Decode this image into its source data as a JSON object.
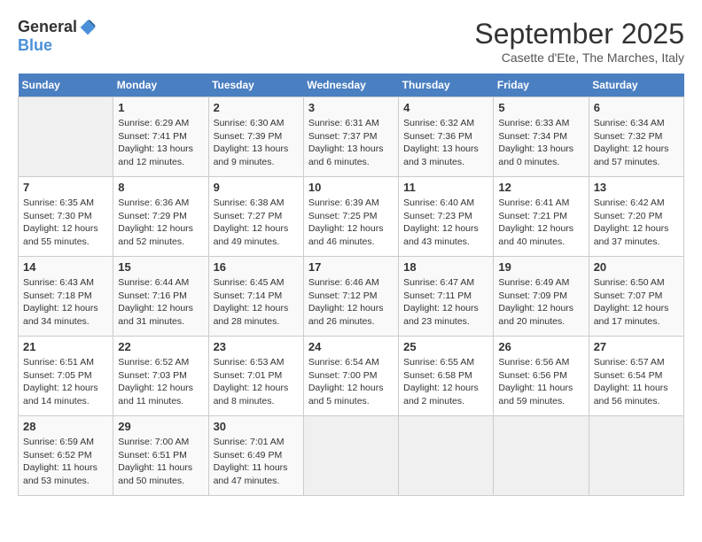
{
  "logo": {
    "general": "General",
    "blue": "Blue"
  },
  "header": {
    "month": "September 2025",
    "location": "Casette d'Ete, The Marches, Italy"
  },
  "weekdays": [
    "Sunday",
    "Monday",
    "Tuesday",
    "Wednesday",
    "Thursday",
    "Friday",
    "Saturday"
  ],
  "weeks": [
    [
      {
        "day": "",
        "empty": true
      },
      {
        "day": "1",
        "sunrise": "Sunrise: 6:29 AM",
        "sunset": "Sunset: 7:41 PM",
        "daylight": "Daylight: 13 hours and 12 minutes."
      },
      {
        "day": "2",
        "sunrise": "Sunrise: 6:30 AM",
        "sunset": "Sunset: 7:39 PM",
        "daylight": "Daylight: 13 hours and 9 minutes."
      },
      {
        "day": "3",
        "sunrise": "Sunrise: 6:31 AM",
        "sunset": "Sunset: 7:37 PM",
        "daylight": "Daylight: 13 hours and 6 minutes."
      },
      {
        "day": "4",
        "sunrise": "Sunrise: 6:32 AM",
        "sunset": "Sunset: 7:36 PM",
        "daylight": "Daylight: 13 hours and 3 minutes."
      },
      {
        "day": "5",
        "sunrise": "Sunrise: 6:33 AM",
        "sunset": "Sunset: 7:34 PM",
        "daylight": "Daylight: 13 hours and 0 minutes."
      },
      {
        "day": "6",
        "sunrise": "Sunrise: 6:34 AM",
        "sunset": "Sunset: 7:32 PM",
        "daylight": "Daylight: 12 hours and 57 minutes."
      }
    ],
    [
      {
        "day": "7",
        "sunrise": "Sunrise: 6:35 AM",
        "sunset": "Sunset: 7:30 PM",
        "daylight": "Daylight: 12 hours and 55 minutes."
      },
      {
        "day": "8",
        "sunrise": "Sunrise: 6:36 AM",
        "sunset": "Sunset: 7:29 PM",
        "daylight": "Daylight: 12 hours and 52 minutes."
      },
      {
        "day": "9",
        "sunrise": "Sunrise: 6:38 AM",
        "sunset": "Sunset: 7:27 PM",
        "daylight": "Daylight: 12 hours and 49 minutes."
      },
      {
        "day": "10",
        "sunrise": "Sunrise: 6:39 AM",
        "sunset": "Sunset: 7:25 PM",
        "daylight": "Daylight: 12 hours and 46 minutes."
      },
      {
        "day": "11",
        "sunrise": "Sunrise: 6:40 AM",
        "sunset": "Sunset: 7:23 PM",
        "daylight": "Daylight: 12 hours and 43 minutes."
      },
      {
        "day": "12",
        "sunrise": "Sunrise: 6:41 AM",
        "sunset": "Sunset: 7:21 PM",
        "daylight": "Daylight: 12 hours and 40 minutes."
      },
      {
        "day": "13",
        "sunrise": "Sunrise: 6:42 AM",
        "sunset": "Sunset: 7:20 PM",
        "daylight": "Daylight: 12 hours and 37 minutes."
      }
    ],
    [
      {
        "day": "14",
        "sunrise": "Sunrise: 6:43 AM",
        "sunset": "Sunset: 7:18 PM",
        "daylight": "Daylight: 12 hours and 34 minutes."
      },
      {
        "day": "15",
        "sunrise": "Sunrise: 6:44 AM",
        "sunset": "Sunset: 7:16 PM",
        "daylight": "Daylight: 12 hours and 31 minutes."
      },
      {
        "day": "16",
        "sunrise": "Sunrise: 6:45 AM",
        "sunset": "Sunset: 7:14 PM",
        "daylight": "Daylight: 12 hours and 28 minutes."
      },
      {
        "day": "17",
        "sunrise": "Sunrise: 6:46 AM",
        "sunset": "Sunset: 7:12 PM",
        "daylight": "Daylight: 12 hours and 26 minutes."
      },
      {
        "day": "18",
        "sunrise": "Sunrise: 6:47 AM",
        "sunset": "Sunset: 7:11 PM",
        "daylight": "Daylight: 12 hours and 23 minutes."
      },
      {
        "day": "19",
        "sunrise": "Sunrise: 6:49 AM",
        "sunset": "Sunset: 7:09 PM",
        "daylight": "Daylight: 12 hours and 20 minutes."
      },
      {
        "day": "20",
        "sunrise": "Sunrise: 6:50 AM",
        "sunset": "Sunset: 7:07 PM",
        "daylight": "Daylight: 12 hours and 17 minutes."
      }
    ],
    [
      {
        "day": "21",
        "sunrise": "Sunrise: 6:51 AM",
        "sunset": "Sunset: 7:05 PM",
        "daylight": "Daylight: 12 hours and 14 minutes."
      },
      {
        "day": "22",
        "sunrise": "Sunrise: 6:52 AM",
        "sunset": "Sunset: 7:03 PM",
        "daylight": "Daylight: 12 hours and 11 minutes."
      },
      {
        "day": "23",
        "sunrise": "Sunrise: 6:53 AM",
        "sunset": "Sunset: 7:01 PM",
        "daylight": "Daylight: 12 hours and 8 minutes."
      },
      {
        "day": "24",
        "sunrise": "Sunrise: 6:54 AM",
        "sunset": "Sunset: 7:00 PM",
        "daylight": "Daylight: 12 hours and 5 minutes."
      },
      {
        "day": "25",
        "sunrise": "Sunrise: 6:55 AM",
        "sunset": "Sunset: 6:58 PM",
        "daylight": "Daylight: 12 hours and 2 minutes."
      },
      {
        "day": "26",
        "sunrise": "Sunrise: 6:56 AM",
        "sunset": "Sunset: 6:56 PM",
        "daylight": "Daylight: 11 hours and 59 minutes."
      },
      {
        "day": "27",
        "sunrise": "Sunrise: 6:57 AM",
        "sunset": "Sunset: 6:54 PM",
        "daylight": "Daylight: 11 hours and 56 minutes."
      }
    ],
    [
      {
        "day": "28",
        "sunrise": "Sunrise: 6:59 AM",
        "sunset": "Sunset: 6:52 PM",
        "daylight": "Daylight: 11 hours and 53 minutes."
      },
      {
        "day": "29",
        "sunrise": "Sunrise: 7:00 AM",
        "sunset": "Sunset: 6:51 PM",
        "daylight": "Daylight: 11 hours and 50 minutes."
      },
      {
        "day": "30",
        "sunrise": "Sunrise: 7:01 AM",
        "sunset": "Sunset: 6:49 PM",
        "daylight": "Daylight: 11 hours and 47 minutes."
      },
      {
        "day": "",
        "empty": true
      },
      {
        "day": "",
        "empty": true
      },
      {
        "day": "",
        "empty": true
      },
      {
        "day": "",
        "empty": true
      }
    ]
  ]
}
